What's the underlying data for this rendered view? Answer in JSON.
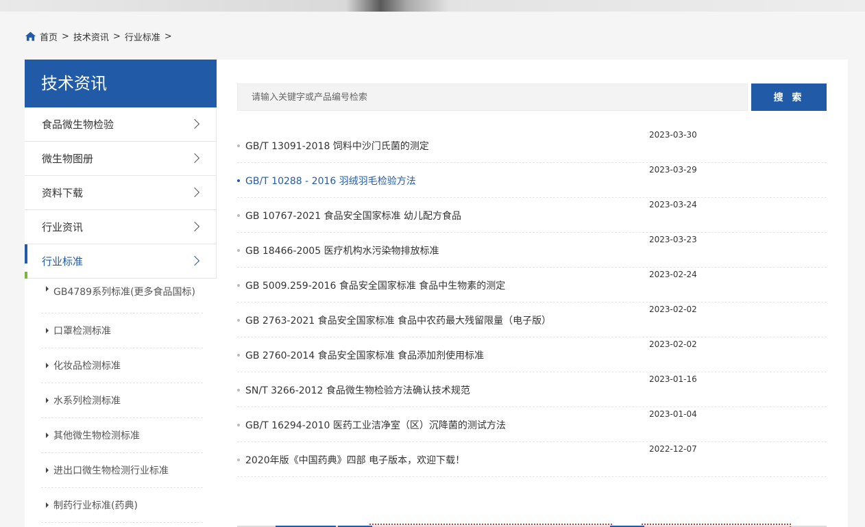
{
  "breadcrumb": {
    "home": "首页",
    "sep": ">",
    "items": [
      "技术资讯",
      "行业标准"
    ]
  },
  "sidebar": {
    "title": "技术资讯",
    "categories": [
      {
        "label": "食品微生物检验"
      },
      {
        "label": "微生物图册"
      },
      {
        "label": "资料下载"
      },
      {
        "label": "行业资讯"
      },
      {
        "label": "行业标准",
        "active": true
      }
    ],
    "subcategories": [
      {
        "label": "GB4789系列标准(更多食品国标)"
      },
      {
        "label": "口罩检测标准"
      },
      {
        "label": "化妆品检测标准"
      },
      {
        "label": "水系列检测标准"
      },
      {
        "label": "其他微生物检测标准"
      },
      {
        "label": "进出口微生物检测行业标准"
      },
      {
        "label": "制药行业标准(药典)"
      }
    ]
  },
  "search": {
    "placeholder": "请输入关键字或产品编号检索",
    "button_label": "搜 索"
  },
  "articles": [
    {
      "title": "GB/T 13091-2018 饲料中沙门氏菌的测定",
      "date": "2023-03-30"
    },
    {
      "title": "GB/T 10288 - 2016 羽绒羽毛检验方法",
      "date": "2023-03-29",
      "active": true
    },
    {
      "title": "GB 10767-2021 食品安全国家标准 幼儿配方食品",
      "date": "2023-03-24"
    },
    {
      "title": "GB 18466-2005 医疗机构水污染物排放标准",
      "date": "2023-03-23"
    },
    {
      "title": "GB 5009.259-2016 食品安全国家标准 食品中生物素的测定",
      "date": "2023-02-24"
    },
    {
      "title": "GB 2763-2021 食品安全国家标准 食品中农药最大残留限量（电子版）",
      "date": "2023-02-02"
    },
    {
      "title": "GB 2760-2014 食品安全国家标准 食品添加剂使用标准",
      "date": "2023-02-02"
    },
    {
      "title": "SN/T 3266-2012 食品微生物检验方法确认技术规范",
      "date": "2023-01-16"
    },
    {
      "title": "GB/T 16294-2010 医药工业洁净室（区）沉降菌的测试方法",
      "date": "2023-01-04"
    },
    {
      "title": "2020年版《中国药典》四部 电子版本，欢迎下载！",
      "date": "2022-12-07"
    }
  ],
  "colors": {
    "primary": "#215ba8",
    "accent_green": "#7cb342"
  }
}
